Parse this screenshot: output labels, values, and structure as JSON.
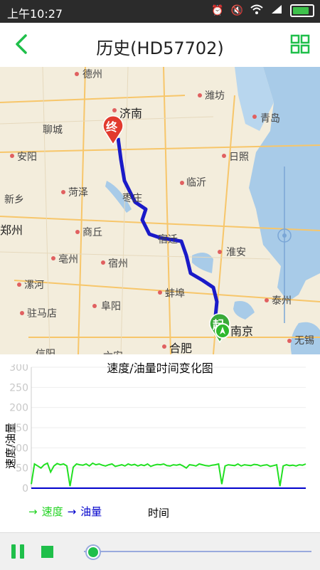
{
  "status_bar": {
    "time": "上午10:27",
    "signal": "4G"
  },
  "header": {
    "title": "历史(HD57702)"
  },
  "map": {
    "cities": [
      {
        "name": "德州"
      },
      {
        "name": "潍坊"
      },
      {
        "name": "济南"
      },
      {
        "name": "聊城"
      },
      {
        "name": "青岛"
      },
      {
        "name": "安阳"
      },
      {
        "name": "日照"
      },
      {
        "name": "新乡"
      },
      {
        "name": "菏泽"
      },
      {
        "name": "临沂"
      },
      {
        "name": "枣庄"
      },
      {
        "name": "郑州"
      },
      {
        "name": "商丘"
      },
      {
        "name": "宿迁"
      },
      {
        "name": "淮安"
      },
      {
        "name": "亳州"
      },
      {
        "name": "宿州"
      },
      {
        "name": "漯河"
      },
      {
        "name": "蚌埠"
      },
      {
        "name": "泰州"
      },
      {
        "name": "驻马店"
      },
      {
        "name": "阜阳"
      },
      {
        "name": "南京"
      },
      {
        "name": "合肥"
      },
      {
        "name": "无锡"
      },
      {
        "name": "信阳"
      },
      {
        "name": "六安"
      }
    ],
    "end_marker": "终",
    "start_marker": "起"
  },
  "chart_data": {
    "type": "line",
    "title": "速度/油量时间变化图",
    "ylabel": "速度/油量",
    "xlabel": "时间",
    "ylim": [
      0,
      300
    ],
    "yticks": [
      "300",
      "250",
      "200",
      "150",
      "100",
      "50",
      "0"
    ],
    "series": [
      {
        "name": "速度",
        "color": "#22e022",
        "values": [
          10,
          60,
          55,
          50,
          58,
          62,
          40,
          55,
          61,
          58,
          60,
          55,
          5,
          52,
          60,
          58,
          57,
          60,
          55,
          62,
          58,
          60,
          57,
          55,
          58,
          60,
          54,
          56,
          58,
          55,
          60,
          57,
          59,
          55,
          58,
          56,
          60,
          54,
          57,
          59,
          58,
          60,
          56,
          55,
          58,
          57,
          59,
          55,
          50,
          58,
          57,
          55,
          60,
          58,
          56,
          55,
          57,
          58,
          60,
          10,
          55,
          58,
          57,
          56,
          60,
          55,
          58,
          57,
          56,
          59,
          58,
          55,
          57,
          58,
          54,
          56,
          58,
          5,
          55,
          58,
          56,
          57,
          55,
          58,
          57,
          60
        ]
      },
      {
        "name": "油量",
        "color": "#0000cc",
        "values": [
          0,
          0,
          0,
          0,
          0,
          0,
          0,
          0,
          0,
          0,
          0,
          0,
          0,
          0,
          0,
          0,
          0,
          0,
          0,
          0,
          0,
          0,
          0,
          0,
          0,
          0,
          0,
          0,
          0,
          0,
          0,
          0,
          0,
          0,
          0,
          0,
          0,
          0,
          0,
          0,
          0,
          0,
          0,
          0,
          0,
          0,
          0,
          0,
          0,
          0,
          0,
          0,
          0,
          0,
          0,
          0,
          0,
          0,
          0,
          0,
          0,
          0,
          0,
          0,
          0,
          0,
          0,
          0,
          0,
          0,
          0,
          0,
          0,
          0,
          0,
          0,
          0,
          0,
          0,
          0,
          0,
          0,
          0,
          0,
          0,
          0
        ]
      }
    ]
  },
  "legend": {
    "speed_label": "速度",
    "fuel_label": "油量",
    "speed_arrow": "→",
    "fuel_arrow": "→"
  },
  "player": {
    "progress": 0.02
  },
  "colors": {
    "accent": "#1fbf4a",
    "route": "#1a1ac8",
    "water": "#a8cbe8"
  }
}
